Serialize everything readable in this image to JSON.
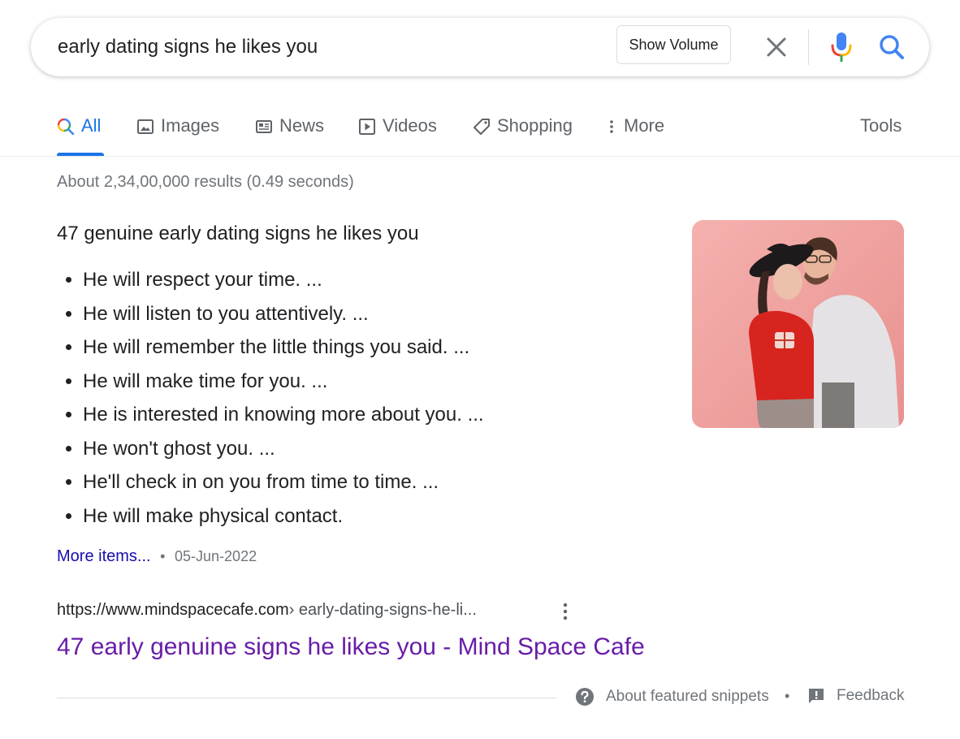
{
  "search": {
    "query": "early dating signs he likes you",
    "show_volume_label": "Show Volume"
  },
  "tabs": [
    {
      "label": "All",
      "icon": "search-multicolor-icon",
      "active": true
    },
    {
      "label": "Images",
      "icon": "image-icon",
      "active": false
    },
    {
      "label": "News",
      "icon": "newspaper-icon",
      "active": false
    },
    {
      "label": "Videos",
      "icon": "play-icon",
      "active": false
    },
    {
      "label": "Shopping",
      "icon": "tag-icon",
      "active": false
    },
    {
      "label": "More",
      "icon": "vertical-dots-icon",
      "active": false
    }
  ],
  "tools_label": "Tools",
  "result_stats": "About 2,34,00,000 results (0.49 seconds)",
  "snippet": {
    "heading": "47 genuine early dating signs he likes you",
    "items": [
      "He will respect your time. ...",
      "He will listen to you attentively. ...",
      "He will remember the little things you said. ...",
      "He will make time for you. ...",
      "He is interested in knowing more about you. ...",
      "He won't ghost you. ...",
      "He'll check in on you from time to time. ...",
      "He will make physical contact."
    ],
    "more_items_label": "More items...",
    "separator": "•",
    "date": "05-Jun-2022"
  },
  "result": {
    "domain": "https://www.mindspacecafe.com",
    "path": " › early-dating-signs-he-li...",
    "title": "47 early genuine signs he likes you - Mind Space Cafe"
  },
  "footer": {
    "about_label": "About featured snippets",
    "dot": "•",
    "feedback_label": "Feedback"
  },
  "colors": {
    "link_blue": "#1a0dab",
    "visited_purple": "#681da8",
    "active_tab_blue": "#1a73e8",
    "muted_gray": "#70757a"
  }
}
